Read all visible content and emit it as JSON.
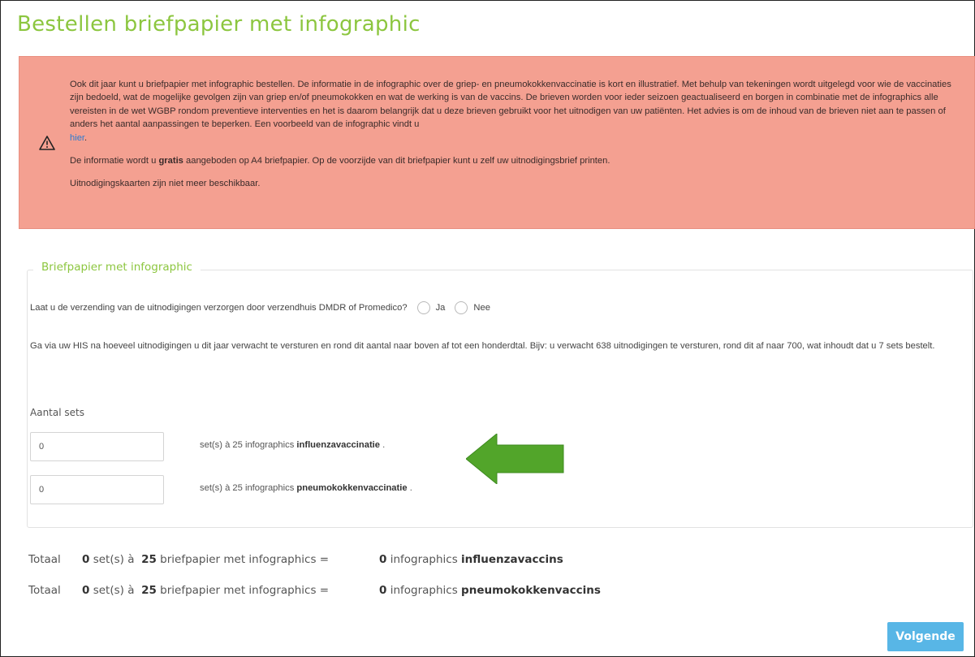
{
  "page": {
    "title": "Bestellen briefpapier met infographic"
  },
  "alert": {
    "icon": "warning-icon",
    "paragraph1": "Ook dit jaar kunt u briefpapier met infographic bestellen. De informatie in de infographic over de griep- en pneumokokkenvaccinatie is kort en illustratief. Met behulp van tekeningen wordt uitgelegd voor wie de vaccinaties zijn bedoeld, wat de mogelijke gevolgen zijn van griep en/of pneumokokken en wat de werking is van de vaccins. De brieven worden voor ieder seizoen geactualiseerd en borgen in combinatie met de infographics alle vereisten in de wet WGBP rondom preventieve interventies en het is daarom belangrijk dat u deze brieven gebruikt voor het uitnodigen van uw patiënten. Het advies is om de inhoud van de brieven niet aan te passen of anders het aantal aanpassingen te beperken. Een voorbeeld van de infographic vindt u",
    "link_text": "hier",
    "paragraph2_before": "De informatie wordt u",
    "paragraph2_bold": "gratis",
    "paragraph2_after": "aangeboden op A4 briefpapier. Op de voorzijde van dit briefpapier kunt u zelf uw uitnodigingsbrief printen.",
    "paragraph3": "Uitnodigingskaarten zijn niet meer beschikbaar."
  },
  "section": {
    "legend": "Briefpapier met infographic",
    "question": "Laat u de verzending van de uitnodigingen verzorgen door verzendhuis DMDR of Promedico?",
    "option_yes": "Ja",
    "option_no": "Nee",
    "help_text": "Ga via uw HIS na hoeveel uitnodigingen u dit jaar verwacht te versturen en rond dit aantal naar boven af tot een honderdtal. Bijv: u verwacht 638 uitnodigingen te versturen, rond dit af naar 700, wat inhoudt dat u 7 sets bestelt.",
    "sets_label": "Aantal sets",
    "rows": [
      {
        "value": "0",
        "prefix": "set(s) à 25 infographics",
        "name": "influenzavaccinatie",
        "suffix": "."
      },
      {
        "value": "0",
        "prefix": "set(s) à 25 infographics",
        "name": "pneumokokkenvaccinatie",
        "suffix": "."
      }
    ]
  },
  "totals": [
    {
      "label": "Totaal",
      "sets": "0",
      "sets_text": "set(s) à",
      "per": "25",
      "per_text": "briefpapier met infographics =",
      "count": "0",
      "count_text": "infographics",
      "vaccine": "influenzavaccins"
    },
    {
      "label": "Totaal",
      "sets": "0",
      "sets_text": "set(s) à",
      "per": "25",
      "per_text": "briefpapier met infographics =",
      "count": "0",
      "count_text": "infographics",
      "vaccine": "pneumokokkenvaccins"
    }
  ],
  "actions": {
    "next_label": "Volgende"
  },
  "colors": {
    "accent_green": "#8cc63f",
    "alert_bg": "#f4a091",
    "button_blue": "#58b6e6",
    "arrow_green": "#52a52a"
  }
}
